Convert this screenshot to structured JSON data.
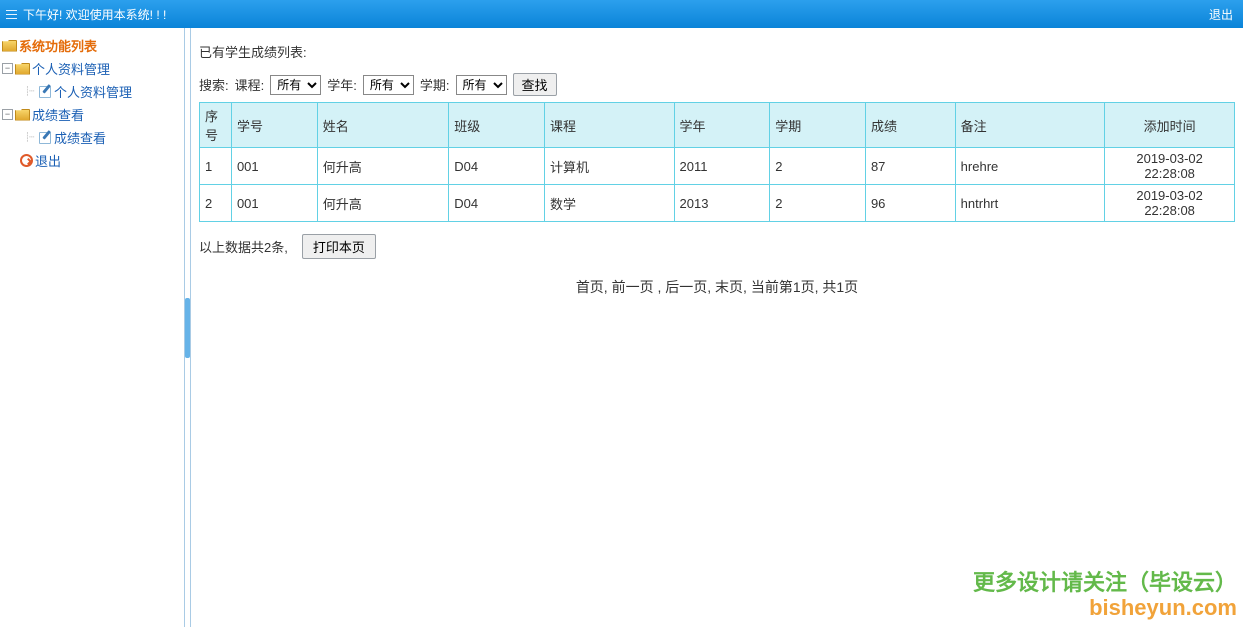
{
  "header": {
    "welcome": "下午好! 欢迎使用本系统! ! !",
    "logout": "退出"
  },
  "sidebar": {
    "rootLabel": "系统功能列表",
    "nodes": [
      {
        "label": "个人资料管理",
        "leaf": {
          "label": "个人资料管理"
        }
      },
      {
        "label": "成绩查看",
        "leaf": {
          "label": "成绩查看"
        }
      }
    ],
    "exitLabel": "退出"
  },
  "main": {
    "listTitle": "已有学生成绩列表:",
    "search": {
      "prefix": "搜索:",
      "courseLabel": "课程:",
      "courseOptions": [
        "所有"
      ],
      "yearLabel": "学年:",
      "yearOptions": [
        "所有"
      ],
      "termLabel": "学期:",
      "termOptions": [
        "所有"
      ],
      "buttonLabel": "查找"
    },
    "table": {
      "headers": [
        "序号",
        "学号",
        "姓名",
        "班级",
        "课程",
        "学年",
        "学期",
        "成绩",
        "备注",
        "添加时间"
      ],
      "rows": [
        [
          "1",
          "001",
          "何升高",
          "D04",
          "计算机",
          "2011",
          "2",
          "87",
          "hrehre",
          "2019-03-02 22:28:08"
        ],
        [
          "2",
          "001",
          "何升高",
          "D04",
          "数学",
          "2013",
          "2",
          "96",
          "hntrhrt",
          "2019-03-02 22:28:08"
        ]
      ]
    },
    "summaryText": "以上数据共2条,",
    "printLabel": "打印本页",
    "pager": "首页,  前一页 , 后一页,  末页,  当前第1页, 共1页"
  },
  "watermark": {
    "line1": "更多设计请关注（毕设云）",
    "line2": "bisheyun.com"
  }
}
